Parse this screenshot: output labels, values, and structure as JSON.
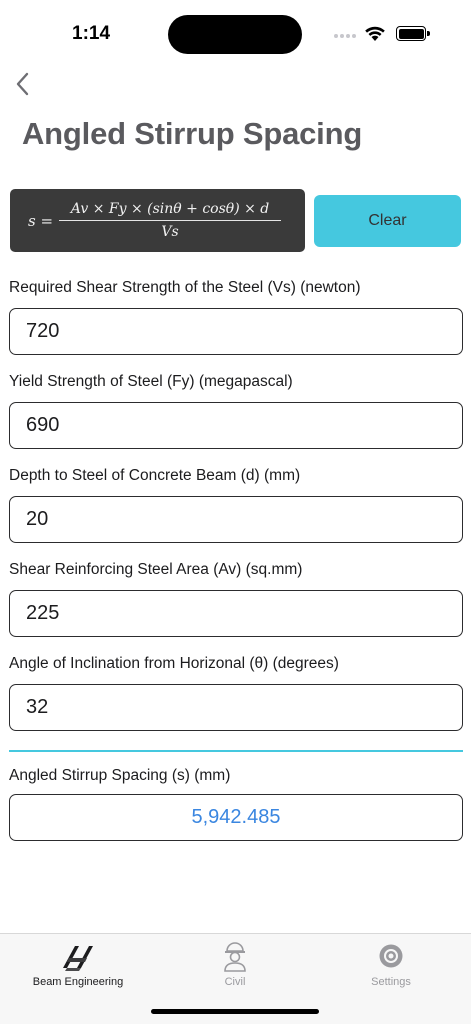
{
  "status": {
    "time": "1:14"
  },
  "header": {
    "title": "Angled Stirrup Spacing"
  },
  "formula": {
    "lhs": "s =",
    "numerator": "Av × Fy × (sinθ + cosθ) × d",
    "denominator": "Vs"
  },
  "actions": {
    "clear_label": "Clear"
  },
  "fields": [
    {
      "label": "Required Shear Strength of the Steel (Vs) (newton)",
      "value": "720"
    },
    {
      "label": "Yield Strength of Steel (Fy) (megapascal)",
      "value": "690"
    },
    {
      "label": "Depth to Steel of Concrete Beam (d) (mm)",
      "value": "20"
    },
    {
      "label": "Shear Reinforcing Steel Area (Av) (sq.mm)",
      "value": "225"
    },
    {
      "label": "Angle of Inclination from Horizonal (θ) (degrees)",
      "value": "32"
    }
  ],
  "result": {
    "label": "Angled Stirrup Spacing (s) (mm)",
    "value": "5,942.485"
  },
  "tabs": [
    {
      "label": "Beam Engineering",
      "icon": "beam-icon",
      "active": true
    },
    {
      "label": "Civil",
      "icon": "worker-icon",
      "active": false
    },
    {
      "label": "Settings",
      "icon": "gear-icon",
      "active": false
    }
  ],
  "colors": {
    "accent": "#45c8df",
    "result": "#3a86e0",
    "formula_bg": "#3a3a3a"
  }
}
